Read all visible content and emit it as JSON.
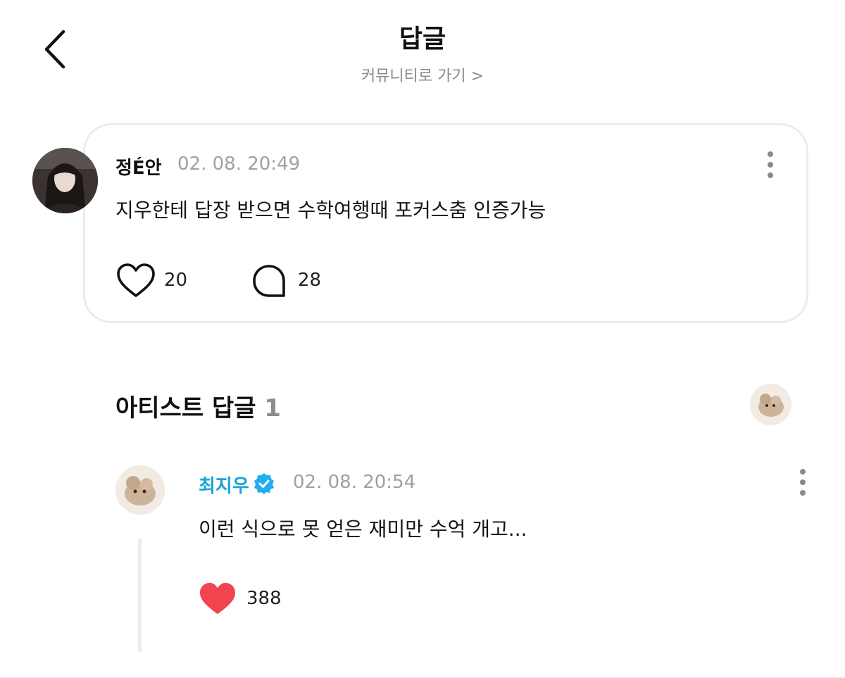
{
  "header": {
    "title": "답글",
    "community_link": "커뮤니티로 가기 >"
  },
  "post": {
    "author": "정É안",
    "date": "02. 08. 20:49",
    "text": "지우한테 답장 받으면 수학여행때 포커스춤 인증가능",
    "likes": "20",
    "comments": "28"
  },
  "artist_section": {
    "title": "아티스트 답글",
    "count": "1"
  },
  "reply": {
    "author": "최지우",
    "verified": true,
    "date": "02. 08. 20:54",
    "text": "이런 식으로 못 얻은 재미만 수억 개고...",
    "likes": "388"
  },
  "colors": {
    "artist_name": "#1aa3d9",
    "verified_badge": "#22aef0",
    "liked_heart": "#f2444e",
    "muted_text": "#a0a0a0"
  }
}
